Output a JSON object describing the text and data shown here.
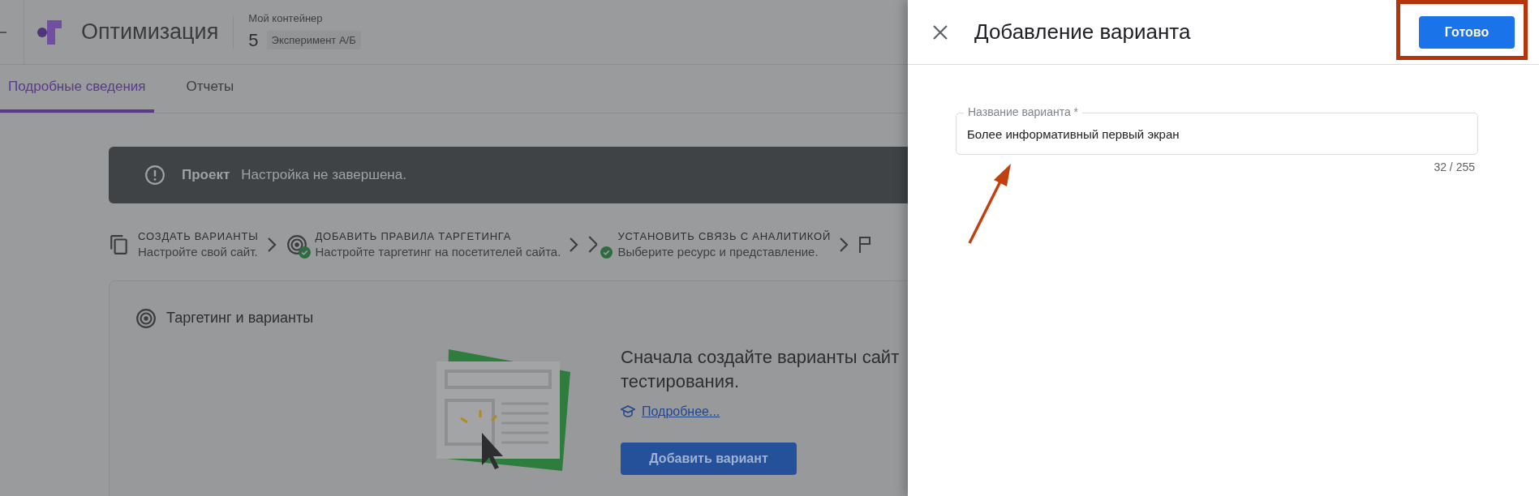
{
  "header": {
    "product": "Оптимизация",
    "container_label": "Мой контейнер",
    "experiment_number": "5",
    "experiment_type": "Эксперимент А/Б"
  },
  "tabs": [
    {
      "label": "Подробные сведения",
      "selected": true
    },
    {
      "label": "Отчеты",
      "selected": false
    }
  ],
  "banner": {
    "title": "Проект",
    "message": "Настройка не завершена."
  },
  "steps": [
    {
      "kind": "variants",
      "title": "СОЗДАТЬ ВАРИАНТЫ",
      "subtitle": "Настройте свой сайт.",
      "done": false
    },
    {
      "kind": "targeting",
      "title": "ДОБАВИТЬ ПРАВИЛА ТАРГЕТИНГА",
      "subtitle": "Настройте таргетинг на посетителей сайта.",
      "done": true
    },
    {
      "kind": "analytics",
      "title": "УСТАНОВИТЬ СВЯЗЬ С АНАЛИТИКОЙ",
      "subtitle": "Выберите ресурс и представление.",
      "done": true
    }
  ],
  "card": {
    "title": "Таргетинг и варианты",
    "message_lines": [
      "Сначала создайте варианты сайт",
      "тестирования."
    ],
    "link": "Подробнее...",
    "button": "Добавить вариант"
  },
  "panel": {
    "title": "Добавление варианта",
    "done_button": "Готово",
    "field": {
      "label": "Название варианта *",
      "value": "Более информативный первый экран",
      "counter": "32 / 255"
    }
  }
}
